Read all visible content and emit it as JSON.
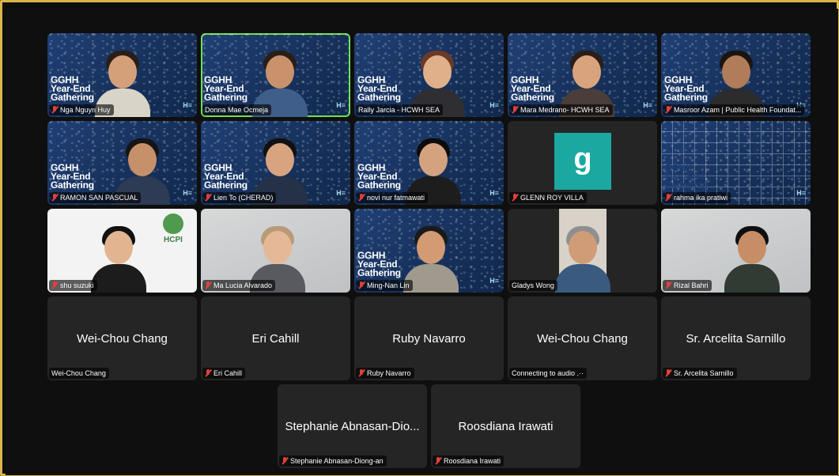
{
  "banner_lines": [
    "GGHH",
    "Year-End",
    "Gathering"
  ],
  "brand_text": "H≡",
  "colors": {
    "frame": "#d9b44a",
    "active_speaker": "#6ee04f",
    "muted": "#e0403a",
    "avatar_g": "#1aa8a0"
  },
  "row1": [
    {
      "name": "Nga Nguyn Huy",
      "muted": true
    },
    {
      "name": "Donna Mae Ocmeja",
      "muted": false
    },
    {
      "name": "Rally Jarcia - HCWH SEA",
      "muted": false
    },
    {
      "name": "Mara Medrano- HCWH SEA",
      "muted": true
    },
    {
      "name": "Masroor Azam | Public Health Foundat...",
      "muted": true
    }
  ],
  "row2": [
    {
      "name": "RAMON SAN PASCUAL",
      "muted": true
    },
    {
      "name": "Lien To (CHERAD)",
      "muted": true
    },
    {
      "name": "novi nur fatmawati",
      "muted": true
    },
    {
      "name": "GLENN ROY VILLA",
      "muted": true,
      "avatar_letter": "g"
    },
    {
      "name": "rahma ika pratiwi",
      "muted": true
    }
  ],
  "row3": [
    {
      "name": "shu suzuki",
      "muted": true,
      "logo": "HCPI"
    },
    {
      "name": "Ma Lucia Alvarado",
      "muted": true
    },
    {
      "name": "Ming-Nan Lin",
      "muted": true
    },
    {
      "name": "Gladys Wong",
      "muted": false
    },
    {
      "name": "Rizal Bahri",
      "muted": true
    }
  ],
  "row4": [
    {
      "display": "Wei-Chou Chang",
      "label": "Wei-Chou Chang",
      "muted": false
    },
    {
      "display": "Eri Cahill",
      "label": "Eri Cahill",
      "muted": true
    },
    {
      "display": "Ruby Navarro",
      "label": "Ruby Navarro",
      "muted": true
    },
    {
      "display": "Wei-Chou Chang",
      "label": "Connecting to audio  .··",
      "muted": false
    },
    {
      "display": "Sr. Arcelita Sarnillo",
      "label": "Sr. Arcelita Sarnillo",
      "muted": true
    }
  ],
  "row5": [
    {
      "display": "Stephanie Abnasan-Dio...",
      "label": "Stephanie Abnasan-Diong-an",
      "muted": true
    },
    {
      "display": "Roosdiana Irawati",
      "label": "Roosdiana Irawati",
      "muted": true
    }
  ]
}
